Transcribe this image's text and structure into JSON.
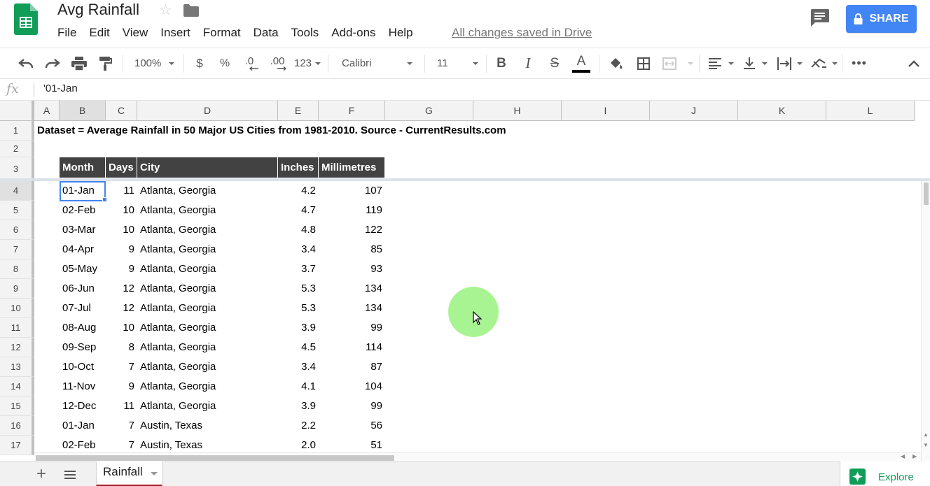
{
  "app": {
    "title": "Avg Rainfall",
    "saved_status": "All changes saved in Drive",
    "share_label": "SHARE"
  },
  "menu": [
    "File",
    "Edit",
    "View",
    "Insert",
    "Format",
    "Data",
    "Tools",
    "Add-ons",
    "Help"
  ],
  "toolbar": {
    "zoom": "100%",
    "currency": "$",
    "percent": "%",
    "decrease_decimals": ".0",
    "increase_decimals": ".00",
    "more_formats": "123",
    "font": "Calibri",
    "font_size": "11",
    "text_color_bar": "#000000"
  },
  "formula_bar": {
    "fx_label": "fx",
    "value": "'01-Jan"
  },
  "columns": [
    "A",
    "B",
    "C",
    "D",
    "E",
    "F",
    "G",
    "H",
    "I",
    "J",
    "K",
    "L"
  ],
  "rows": [
    "1",
    "2",
    "3",
    "4",
    "5",
    "6",
    "7",
    "8",
    "9",
    "10",
    "11",
    "12",
    "13",
    "14",
    "15",
    "16",
    "17"
  ],
  "sheet": {
    "title_text": "Dataset = Average Rainfall in 50 Major US Cities from 1981-2010.  Source - CurrentResults.com",
    "headers": [
      "Month",
      "Days",
      "City",
      "Inches",
      "Millimetres"
    ],
    "data": [
      [
        "01-Jan",
        "11",
        "Atlanta, Georgia",
        "4.2",
        "107"
      ],
      [
        "02-Feb",
        "10",
        "Atlanta, Georgia",
        "4.7",
        "119"
      ],
      [
        "03-Mar",
        "10",
        "Atlanta, Georgia",
        "4.8",
        "122"
      ],
      [
        "04-Apr",
        "9",
        "Atlanta, Georgia",
        "3.4",
        "85"
      ],
      [
        "05-May",
        "9",
        "Atlanta, Georgia",
        "3.7",
        "93"
      ],
      [
        "06-Jun",
        "12",
        "Atlanta, Georgia",
        "5.3",
        "134"
      ],
      [
        "07-Jul",
        "12",
        "Atlanta, Georgia",
        "5.3",
        "134"
      ],
      [
        "08-Aug",
        "10",
        "Atlanta, Georgia",
        "3.9",
        "99"
      ],
      [
        "09-Sep",
        "8",
        "Atlanta, Georgia",
        "4.5",
        "114"
      ],
      [
        "10-Oct",
        "7",
        "Atlanta, Georgia",
        "3.4",
        "87"
      ],
      [
        "11-Nov",
        "9",
        "Atlanta, Georgia",
        "4.1",
        "104"
      ],
      [
        "12-Dec",
        "11",
        "Atlanta, Georgia",
        "3.9",
        "99"
      ],
      [
        "01-Jan",
        "7",
        "Austin, Texas",
        "2.2",
        "56"
      ],
      [
        "02-Feb",
        "7",
        "Austin, Texas",
        "2.0",
        "51"
      ]
    ],
    "header_bg": "#424242"
  },
  "bottom": {
    "sheet_tab": "Rainfall",
    "explore_label": "Explore"
  },
  "colors": {
    "accent_blue": "#4285f4",
    "sheets_green": "#0f9d58",
    "active_tab_underline": "#a51c1c"
  }
}
